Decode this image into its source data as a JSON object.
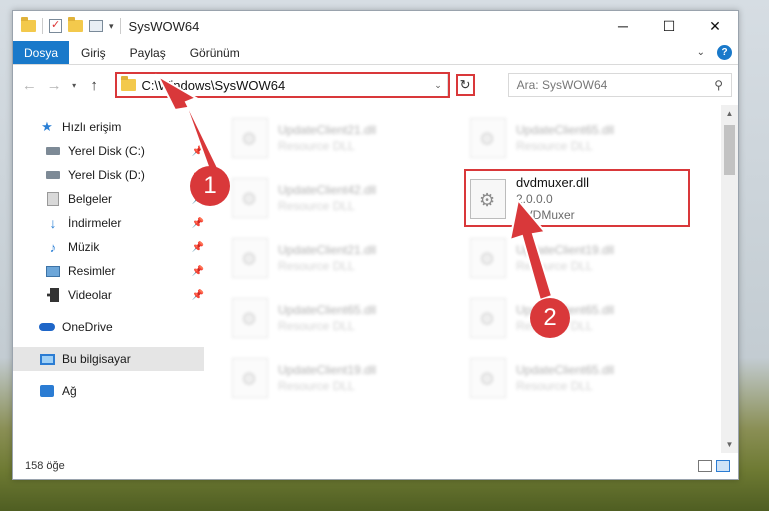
{
  "window": {
    "title": "SysWOW64"
  },
  "ribbon": {
    "file_tab": "Dosya",
    "tabs": [
      "Giriş",
      "Paylaş",
      "Görünüm"
    ],
    "help": "?"
  },
  "navigation": {
    "address": "C:\\Windows\\SysWOW64",
    "search_placeholder": "Ara: SysWOW64"
  },
  "sidebar": {
    "items": [
      {
        "label": "Hızlı erişim",
        "icon": "star-icon",
        "pinned": false
      },
      {
        "label": "Yerel Disk (C:)",
        "icon": "drive-icon",
        "pinned": true
      },
      {
        "label": "Yerel Disk (D:)",
        "icon": "drive-icon",
        "pinned": true
      },
      {
        "label": "Belgeler",
        "icon": "documents-icon",
        "pinned": true
      },
      {
        "label": "İndirmeler",
        "icon": "download-icon",
        "pinned": true
      },
      {
        "label": "Müzik",
        "icon": "music-icon",
        "pinned": true
      },
      {
        "label": "Resimler",
        "icon": "pictures-icon",
        "pinned": true
      },
      {
        "label": "Videolar",
        "icon": "video-icon",
        "pinned": true
      },
      {
        "label": "OneDrive",
        "icon": "cloud-icon"
      },
      {
        "label": "Bu bilgisayar",
        "icon": "computer-icon",
        "selected": true
      },
      {
        "label": "Ağ",
        "icon": "network-icon"
      }
    ]
  },
  "files": [
    {
      "name": "UpdateClient21.dll",
      "type": "Resource DLL"
    },
    {
      "name": "UpdateClient65.dll",
      "type": "Resource DLL"
    },
    {
      "name": "UpdateClient42.dll",
      "type": "Resource DLL"
    },
    {
      "name": "dvdmuxer.dll",
      "version": "2.0.0.0",
      "description": "DVDMuxer",
      "highlighted": true
    },
    {
      "name": "UpdateClient21.dll",
      "type": "Resource DLL"
    },
    {
      "name": "UpdateClient19.dll",
      "type": "Resource DLL"
    },
    {
      "name": "UpdateClient65.dll",
      "type": "Resource DLL"
    },
    {
      "name": "UpdateClient65.dll",
      "type": "Resource DLL"
    },
    {
      "name": "UpdateClient19.dll",
      "type": "Resource DLL"
    },
    {
      "name": "UpdateClient65.dll",
      "type": "Resource DLL"
    }
  ],
  "status": {
    "item_count": "158 öğe"
  },
  "callouts": [
    "1",
    "2"
  ],
  "colors": {
    "accent": "#1979ca",
    "highlight": "#d9383a"
  }
}
